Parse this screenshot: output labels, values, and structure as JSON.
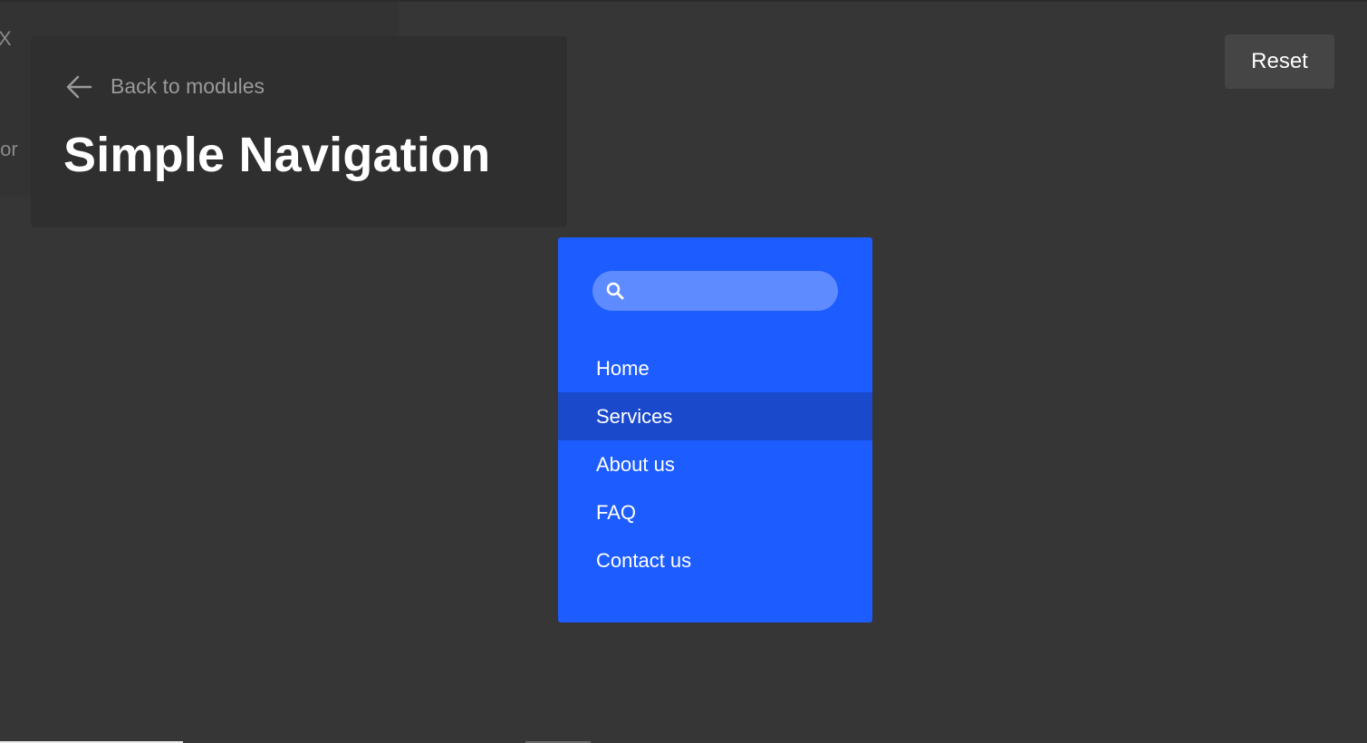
{
  "background_panel": {
    "close_glyph": "X",
    "cut_text": "tor"
  },
  "header": {
    "back_label": "Back to modules",
    "title": "Simple Navigation"
  },
  "toolbar": {
    "reset_label": "Reset"
  },
  "nav": {
    "search": {
      "placeholder": "",
      "value": ""
    },
    "items": [
      {
        "label": "Home",
        "active": false
      },
      {
        "label": "Services",
        "active": true
      },
      {
        "label": "About us",
        "active": false
      },
      {
        "label": "FAQ",
        "active": false
      },
      {
        "label": "Contact us",
        "active": false
      }
    ]
  },
  "colors": {
    "page_background": "#363636",
    "nav_background": "#1d5cff",
    "nav_active": "#1a49cc",
    "search_background": "#5e8bff"
  }
}
